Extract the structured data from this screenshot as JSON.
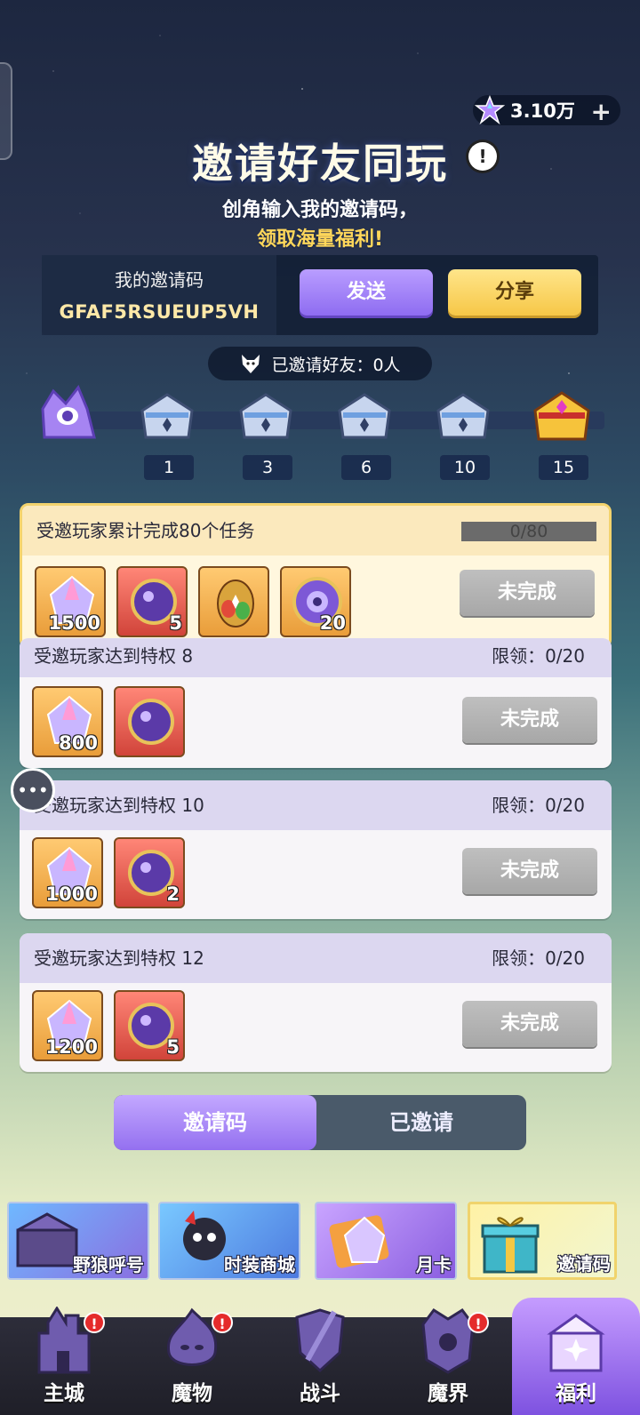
{
  "currency": {
    "amount": "3.10万",
    "icon": "star-gem-icon",
    "plus": "+"
  },
  "header": {
    "title": "邀请好友同玩",
    "info_icon": "!"
  },
  "intro": {
    "line1": "创角输入我的邀请码，",
    "line2": "领取海量福利!"
  },
  "invite_code": {
    "label": "我的邀请码",
    "value": "GFAF5RSUEUP5VH",
    "send_label": "发送",
    "share_label": "分享"
  },
  "invited": {
    "text": "已邀请好友：0人"
  },
  "milestones": [
    "1",
    "3",
    "6",
    "10",
    "15"
  ],
  "tasks": [
    {
      "title": "受邀玩家累计完成80个任务",
      "progress": "0/80",
      "progress_fraction": 0,
      "status": "未完成",
      "rewards": [
        {
          "icon": "crystal-icon",
          "qty": "1500"
        },
        {
          "icon": "cosmic-orb-icon",
          "qty": "5"
        },
        {
          "icon": "egg-icon",
          "qty": ""
        },
        {
          "icon": "seal-coin-icon",
          "qty": "20"
        }
      ]
    },
    {
      "title": "受邀玩家达到特权 8",
      "progress": "限领：0/20",
      "status": "未完成",
      "rewards": [
        {
          "icon": "crystal-icon",
          "qty": "800"
        },
        {
          "icon": "cosmic-orb-icon",
          "qty": ""
        }
      ]
    },
    {
      "title": "受邀玩家达到特权 10",
      "progress": "限领：0/20",
      "status": "未完成",
      "rewards": [
        {
          "icon": "crystal-icon",
          "qty": "1000"
        },
        {
          "icon": "cosmic-orb-icon",
          "qty": "2"
        }
      ]
    },
    {
      "title": "受邀玩家达到特权 12",
      "progress": "限领：0/20",
      "status": "未完成",
      "rewards": [
        {
          "icon": "crystal-icon",
          "qty": "1200"
        },
        {
          "icon": "cosmic-orb-icon",
          "qty": "5"
        }
      ]
    }
  ],
  "tabs": {
    "active": "邀请码",
    "inactive": "已邀请"
  },
  "promos": [
    {
      "label": "野狼呼号"
    },
    {
      "label": "时装商城"
    },
    {
      "label": "月卡"
    },
    {
      "label": "邀请码"
    }
  ],
  "nav": [
    {
      "label": "主城",
      "badge": "!"
    },
    {
      "label": "魔物",
      "badge": "!"
    },
    {
      "label": "战斗",
      "badge": ""
    },
    {
      "label": "魔界",
      "badge": "!"
    },
    {
      "label": "福利",
      "badge": ""
    }
  ],
  "colors": {
    "accent_purple": "#9470f0",
    "accent_gold": "#f6c747",
    "disabled_gray": "#a7a7a7"
  }
}
